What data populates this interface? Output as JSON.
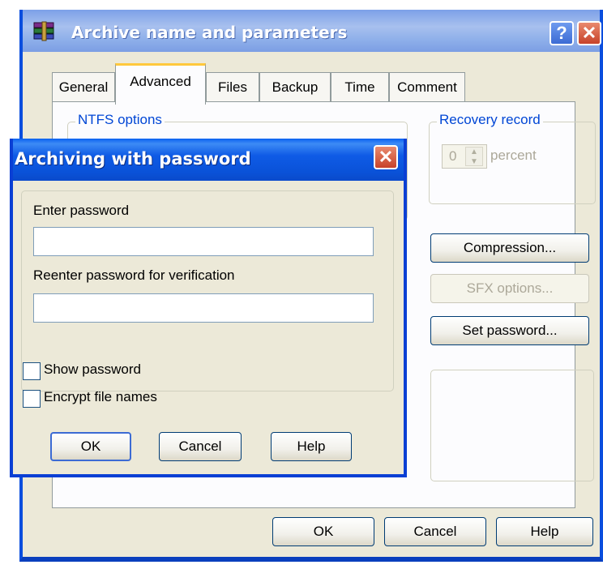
{
  "back_window": {
    "title": "Archive name and parameters",
    "help_icon": "?",
    "close_icon": "✕",
    "tabs": [
      {
        "label": "General"
      },
      {
        "label": "Advanced"
      },
      {
        "label": "Files"
      },
      {
        "label": "Backup"
      },
      {
        "label": "Time"
      },
      {
        "label": "Comment"
      }
    ],
    "ntfs_label": "NTFS options",
    "recovery_label": "Recovery record",
    "recovery_value": "0",
    "recovery_unit": "percent",
    "compression_button": "Compression...",
    "sfx_button": "SFX options...",
    "set_password_button": "Set password...",
    "ok_button": "OK",
    "cancel_button": "Cancel",
    "help_button": "Help"
  },
  "password_dialog": {
    "title": "Archiving with password",
    "close_icon": "✕",
    "enter_label": "Enter password",
    "enter_value": "",
    "reenter_label": "Reenter password for verification",
    "reenter_value": "",
    "show_password_label": "Show password",
    "show_password_checked": false,
    "encrypt_names_label": "Encrypt file names",
    "encrypt_names_checked": false,
    "ok_button": "OK",
    "cancel_button": "Cancel",
    "help_button": "Help"
  },
  "colors": {
    "titlebar_active": "#0a52d8",
    "titlebar_inactive": "#8fb0ea",
    "dialog_face": "#ece9d8",
    "group_label_blue": "#0046d5",
    "tab_highlight": "#ffc83c"
  }
}
